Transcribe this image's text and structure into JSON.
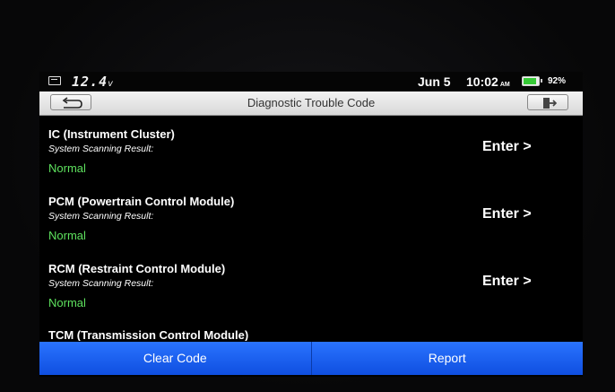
{
  "status": {
    "voltage": "12.4",
    "voltage_unit": "v",
    "date": "Jun 5",
    "time": "10:02",
    "ampm": "AM",
    "battery_pct": "92%",
    "battery_level": 0.92
  },
  "header": {
    "title": "Diagnostic Trouble Code"
  },
  "modules": [
    {
      "name": "IC (Instrument Cluster)",
      "scan_label": "System Scanning Result:",
      "result": "Normal",
      "enter": "Enter >"
    },
    {
      "name": "PCM (Powertrain Control Module)",
      "scan_label": "System Scanning Result:",
      "result": "Normal",
      "enter": "Enter >"
    },
    {
      "name": "RCM (Restraint Control Module)",
      "scan_label": "System Scanning Result:",
      "result": "Normal",
      "enter": "Enter >"
    },
    {
      "name": "TCM (Transmission Control Module)"
    }
  ],
  "actions": {
    "clear_code": "Clear Code",
    "report": "Report"
  },
  "colors": {
    "accent": "#1f66f5",
    "normal": "#5ee25e"
  }
}
